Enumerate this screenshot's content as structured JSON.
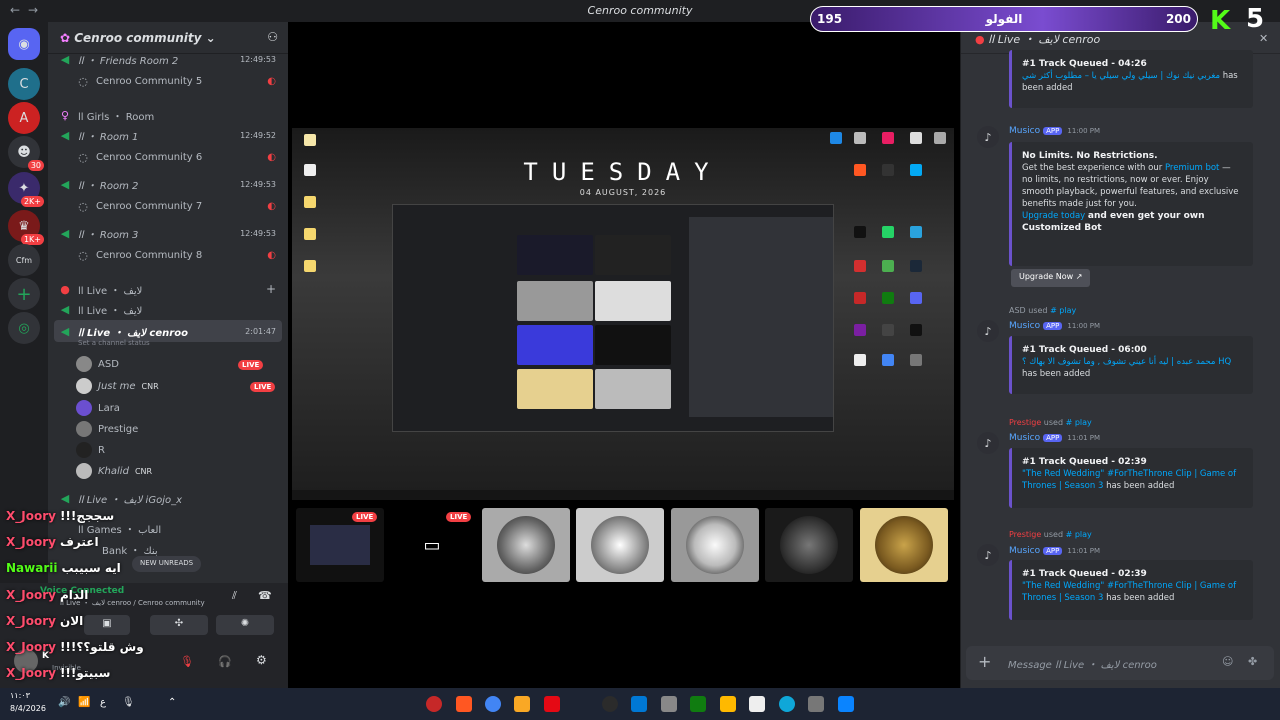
{
  "window": {
    "title": "Cenroo community"
  },
  "guilds": {
    "badges": [
      "30",
      "2K+",
      "1K+"
    ],
    "label": "Cfm"
  },
  "server": {
    "name": "Cenroo community"
  },
  "channels": [
    {
      "label": "اا ・ Friends Room 2",
      "time": "12:49:53"
    },
    {
      "label": "Cenroo Community 5"
    },
    {
      "label": "اا Girls ・ Room"
    },
    {
      "label": "اا ・ Room 1",
      "time": "12:49:52"
    },
    {
      "label": "Cenroo Community 6"
    },
    {
      "label": "اا ・ Room 2",
      "time": "12:49:53"
    },
    {
      "label": "Cenroo Community 7"
    },
    {
      "label": "اا ・ Room 3",
      "time": "12:49:53"
    },
    {
      "label": "Cenroo Community 8"
    },
    {
      "label": "اا Live ・ لايف"
    },
    {
      "label": "اا Live ・ لايف"
    },
    {
      "label": "اا Live ・ لايف cenroo",
      "time": "2:01:47"
    },
    {
      "label": "Set a channel status"
    },
    {
      "label": "اا Live ・ لايف iGojo_x"
    },
    {
      "label": "اا Games ・ العاب"
    },
    {
      "label": "Bank ・ بنك"
    }
  ],
  "members": [
    {
      "name": "ASD",
      "live": "LIVE"
    },
    {
      "name": "Just me",
      "tag": "CNR",
      "live": "LIVE"
    },
    {
      "name": "Lara"
    },
    {
      "name": "Prestige"
    },
    {
      "name": "R"
    },
    {
      "name": "Khalid",
      "tag": "CNR"
    }
  ],
  "new_unreads": "NEW UNREADS",
  "voice": {
    "status": "Voice Connected",
    "channel": "اا Live ・ لايف cenroo / Cenroo community"
  },
  "user": {
    "name": "K",
    "status": "Invisible"
  },
  "stream": {
    "title": "TUESDAY",
    "date": "04 AUGUST, 2026"
  },
  "thumb_badges": [
    "LIVE",
    "LIVE"
  ],
  "chat": {
    "header": "اا Live ・ لايف cenroo",
    "messages": [
      {
        "title": "#1 Track Queued - 04:26",
        "link": "مغربي نيك نوك | سيلي ولي سيلي يا – مطلوب أكثر شي",
        "tail": "has been added"
      },
      {
        "bot": "Musico",
        "app": "APP",
        "ts": "11:00 PM",
        "title": "No Limits. No Restrictions.",
        "body1": "Get the best experience with our",
        "body_link": "Premium bot",
        "body2": "— no limits, no restrictions, now or ever. Enjoy smooth playback, powerful features, and exclusive benefits made just for you.",
        "cta1": "Upgrade today",
        "cta2": "and even get your own Customized Bot",
        "button": "Upgrade Now"
      },
      {
        "used_by": "ASD",
        "used": "used",
        "cmd": "# play",
        "bot": "Musico",
        "app": "APP",
        "ts": "11:00 PM",
        "title": "#1 Track Queued - 06:00",
        "link": "محمد عبده | ليه أنا عيني تشوف , وما تشوف الا بهاك ؟ HQ",
        "tail": "has been added"
      },
      {
        "used_by": "Prestige",
        "used": "used",
        "cmd": "# play",
        "bot": "Musico",
        "app": "APP",
        "ts": "11:01 PM",
        "title": "#1 Track Queued - 02:39",
        "link": "\"The Red Wedding\" #ForTheThrone Clip | Game of Thrones | Season 3",
        "tail": "has been added"
      },
      {
        "used_by": "Prestige",
        "used": "used",
        "cmd": "# play",
        "bot": "Musico",
        "app": "APP",
        "ts": "11:01 PM",
        "title": "#1 Track Queued - 02:39",
        "link": "\"The Red Wedding\" #ForTheThrone Clip | Game of Thrones | Season 3",
        "tail": "has been added"
      }
    ],
    "composer": "Message اا Live ・ لايف cenroo"
  },
  "overlay": {
    "score_left": "195",
    "score_label": "الفولو",
    "score_right": "200",
    "kick_letter": "K",
    "kick_count": "5",
    "comments": [
      {
        "user": "X_Joory",
        "text": "!!!سججج"
      },
      {
        "user": "X_Joory",
        "text": "اعترف"
      },
      {
        "user": "Nawarii",
        "text": "ايه سبيبب"
      },
      {
        "user": "X_Joory",
        "text": "الدام"
      },
      {
        "user": "X_Joory",
        "text": "الان"
      },
      {
        "user": "X_Joory",
        "text": "!!!وش قلتو؟؟"
      },
      {
        "user": "X_Joory",
        "text": "!!!سبيتو"
      }
    ]
  },
  "taskbar": {
    "time": "١١:٠٣",
    "date": "8/4/2026",
    "lang": "ع"
  },
  "colors": {
    "accent": "#5865f2",
    "live": "#f23f43",
    "voice_green": "#23a55a",
    "link": "#00a8fc",
    "kick": "#53fc18"
  }
}
